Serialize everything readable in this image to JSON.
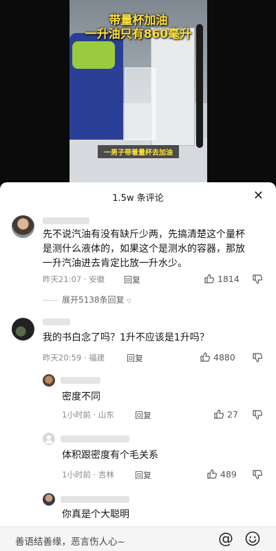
{
  "video": {
    "title_line1": "带量杯加油",
    "title_line2": "一升油只有860毫升",
    "caption": "一男子带着量杯去加油"
  },
  "panel": {
    "count": "1.5w 条评论",
    "close": "✕"
  },
  "comments": [
    {
      "text_lines": [
        "先不说汽油有没有缺斤少两，先搞清楚这个量杯",
        "是测什么液体的，如果这个是测水的容器，那放",
        "一升汽油进去肯定比放一升水少。"
      ],
      "time": "昨天21:07",
      "location": "安徽",
      "reply": "回复",
      "likes": "1814",
      "expand": "展开5138条回复"
    },
    {
      "text": "我的书白念了吗？1升不应该是1升吗？",
      "time": "昨天20:59",
      "location": "福建",
      "reply": "回复",
      "likes": "4880",
      "sub_replies": [
        {
          "text": "密度不同",
          "time": "1小时前",
          "location": "山东",
          "reply": "回复",
          "likes": "27"
        },
        {
          "text": "体积跟密度有个毛关系",
          "time": "1小时前",
          "location": "吉林",
          "reply": "回复",
          "likes": "489"
        },
        {
          "text": "你真是个大聪明"
        }
      ]
    }
  ],
  "input": {
    "placeholder": "善语结善缘，恶言伤人心~",
    "at": "@"
  }
}
